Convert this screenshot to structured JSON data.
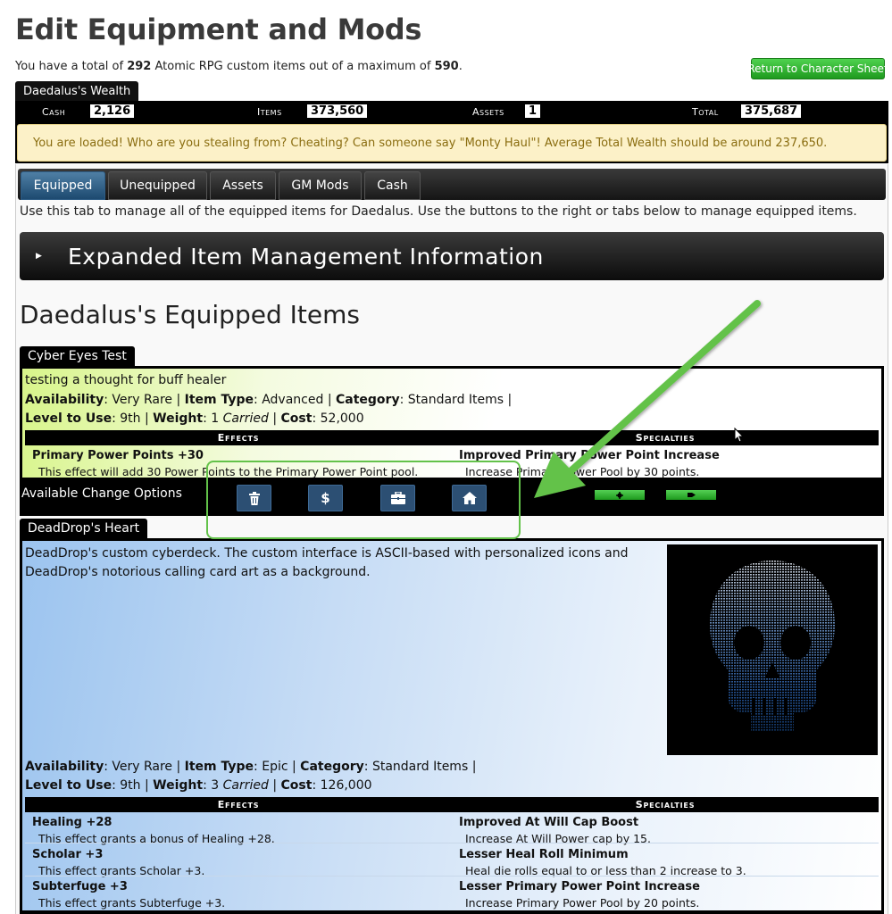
{
  "page": {
    "title": "Edit Equipment and Mods",
    "count_prefix": "You have a total of ",
    "count_current": "292",
    "count_middle": " Atomic RPG custom items out of a maximum of ",
    "count_max": "590",
    "count_suffix": ".",
    "return_button": "Return to Character Sheet"
  },
  "wealth": {
    "tab_label": "Daedalus's Wealth",
    "cash_label": "Cash",
    "cash_value": "2,126",
    "items_label": "Items",
    "items_value": "373,560",
    "assets_label": "Assets",
    "assets_value": "1",
    "total_label": "Total",
    "total_value": "375,687",
    "alert": "You are loaded! Who are you stealing from? Cheating? Can someone say \"Monty Haul\"! Average Total Wealth should be around 237,650."
  },
  "tabs": [
    {
      "label": "Equipped"
    },
    {
      "label": "Unequipped"
    },
    {
      "label": "Assets"
    },
    {
      "label": "GM Mods"
    },
    {
      "label": "Cash"
    }
  ],
  "tab_description": "Use this tab to manage all of the equipped items for Daedalus. Use the buttons to the right or tabs below to manage equipped items.",
  "expand_section": {
    "label": "Expanded Item Management Information"
  },
  "equipped_title": "Daedalus's Equipped Items",
  "labels": {
    "availability": "Availability",
    "item_type": "Item Type",
    "category": "Category",
    "level": "Level to Use",
    "weight": "Weight",
    "carried": "Carried",
    "cost": "Cost",
    "effects": "Effects",
    "specialties": "Specialties",
    "change_options": "Available Change Options",
    "sep": " | "
  },
  "items": [
    {
      "name": "Cyber Eyes Test",
      "description": "testing a thought for buff healer",
      "availability": "Very Rare",
      "item_type": "Advanced",
      "category": "Standard Items",
      "level": "9th",
      "weight": "1",
      "cost": "52,000",
      "effects": [
        {
          "name": "Primary Power Points +30",
          "desc": "This effect will add 30 Power Points to the Primary Power Point pool."
        }
      ],
      "specialties": [
        {
          "name": "Improved Primary Power Point Increase",
          "desc": "Increase Primary Power Pool by 30 points."
        }
      ]
    },
    {
      "name": "DeadDrop's Heart",
      "description_line1": "DeadDrop's custom cyberdeck. The custom interface is ASCII-based with personalized icons and",
      "description_line2": "DeadDrop's notorious calling card art as a background.",
      "availability": "Very Rare",
      "item_type": "Epic",
      "category": "Standard Items",
      "level": "9th",
      "weight": "3",
      "cost": "126,000",
      "effects": [
        {
          "name": "Healing +28",
          "desc": "This effect grants a bonus of Healing +28."
        },
        {
          "name": "Scholar +3",
          "desc": "This effect grants Scholar +3."
        },
        {
          "name": "Subterfuge +3",
          "desc": "This effect grants Subterfuge +3."
        }
      ],
      "specialties": [
        {
          "name": "Improved At Will Cap Boost",
          "desc": "Increase At Will Power cap by 15."
        },
        {
          "name": "Lesser Heal Roll Minimum",
          "desc": "Heal die rolls equal to or less than 2 increase to 3."
        },
        {
          "name": "Lesser Primary Power Point Increase",
          "desc": "Increase Primary Power Pool by 20 points."
        }
      ]
    }
  ],
  "icons": {
    "delete": "trash-icon",
    "cash": "dollar-icon",
    "asset": "briefcase-icon",
    "home": "home-icon"
  },
  "colors": {
    "accent_green": "#2db52d",
    "tab_active": "#2e5c85",
    "alert_bg": "#fcf1c8",
    "alert_text": "#8a6d10",
    "button_blue": "#2c4f73",
    "annotation_green": "#63c24a"
  }
}
